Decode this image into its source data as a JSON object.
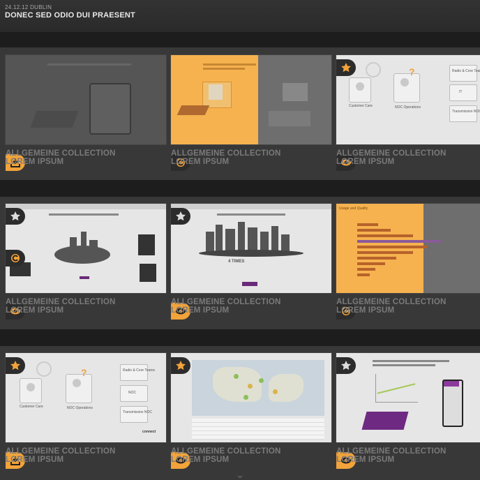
{
  "header": {
    "date_location": "24.12.12 DUBLIN",
    "title": "DONEC SED ODIO DUI PRAESENT"
  },
  "icons": {
    "download": "download-icon",
    "cycle": "refresh-icon",
    "view": "eye-icon",
    "favorite": "star-icon"
  },
  "colors": {
    "accent": "#f2a33a",
    "background": "#2b2b2b",
    "card_title": "#7a7a7a"
  },
  "grid": [
    [
      {
        "title1": "ALLGEMEINE COLLECTION",
        "title2": "LOREM IPSUM"
      },
      {
        "title1": "ALLGEMEINE COLLECTION",
        "title2": "LOREM IPSUM"
      },
      {
        "title1": "ALLGEMEINE COLLECTION",
        "title2": "LOREM IPSUM"
      }
    ],
    [
      {
        "title1": "ALLGEMEINE COLLECTION",
        "title2": "LOREM IPSUM"
      },
      {
        "title1": "ALLGEMEINE COLLECTION",
        "title2": "LOREM IPSUM"
      },
      {
        "title1": "ALLGEMEINE COLLECTION",
        "title2": "LOREM IPSUM"
      }
    ],
    [
      {
        "title1": "ALLGEMEINE COLLECTION",
        "title2": "LOREM IPSUM"
      },
      {
        "title1": "ALLGEMEINE COLLECTION",
        "title2": "LOREM IPSUM"
      },
      {
        "title1": "ALLGEMEINE COLLECTION",
        "title2": "LOREM IPSUM"
      }
    ]
  ],
  "thumb_text": {
    "customer_care": "Customer Care",
    "noc_operations": "NOC Operations",
    "radio_core_teams": "Radio & Core Teams",
    "it": "IT",
    "noc": "NOC",
    "transmission_noc": "Transmission NOC",
    "connect": "connect",
    "times": "4 TIMES",
    "usage": "Usage and Quality"
  }
}
